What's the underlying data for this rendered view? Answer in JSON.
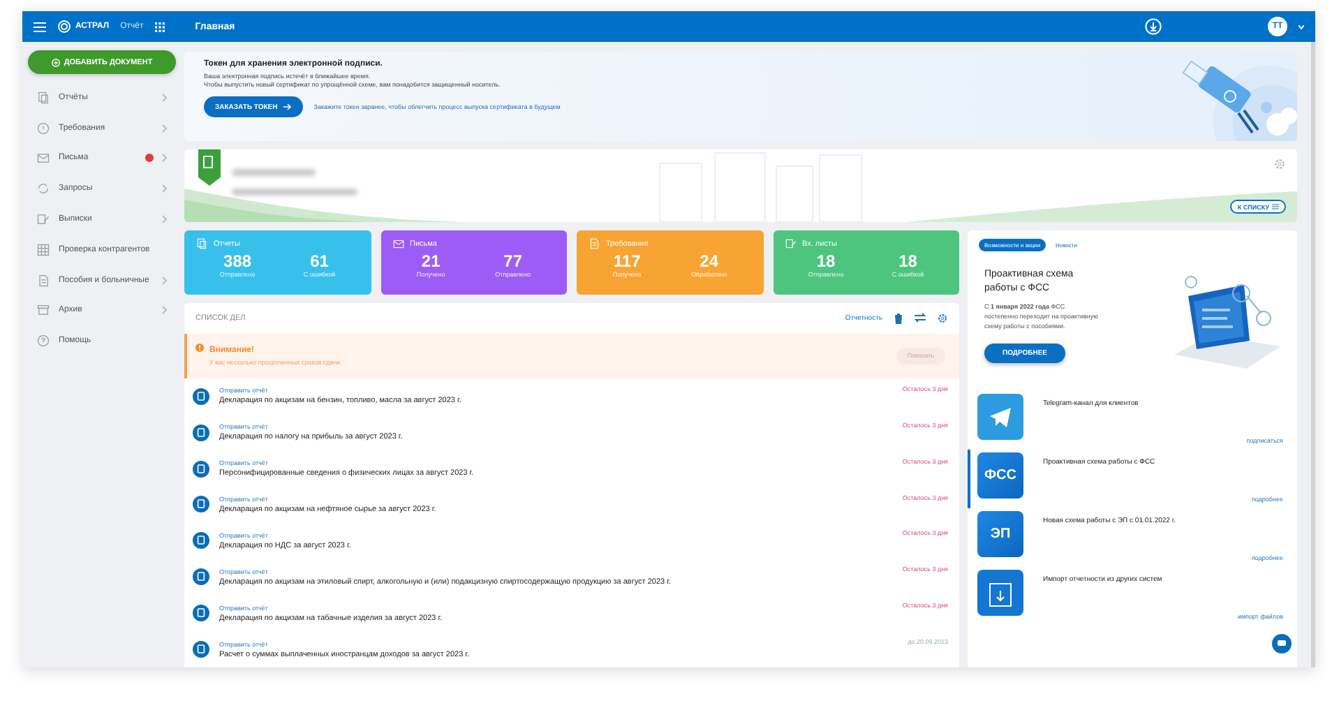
{
  "header": {
    "brand": "АСТРАЛ",
    "product": "Отчёт",
    "title": "Главная",
    "avatar": "ТТ"
  },
  "sidebar": {
    "add_button": "ДОБАВИТЬ ДОКУМЕНТ",
    "items": [
      {
        "label": "Отчёты",
        "has_arrow": true,
        "badge": false
      },
      {
        "label": "Требования",
        "has_arrow": true,
        "badge": false
      },
      {
        "label": "Письма",
        "has_arrow": true,
        "badge": true
      },
      {
        "label": "Запросы",
        "has_arrow": true,
        "badge": false
      },
      {
        "label": "Выписки",
        "has_arrow": true,
        "badge": false
      },
      {
        "label": "Проверка контрагентов",
        "has_arrow": false,
        "badge": false
      },
      {
        "label": "Пособия и больничные",
        "has_arrow": true,
        "badge": false
      },
      {
        "label": "Архив",
        "has_arrow": true,
        "badge": false
      },
      {
        "label": "Помощь",
        "has_arrow": false,
        "badge": false
      }
    ]
  },
  "token_banner": {
    "title": "Токен для хранения электронной подписи.",
    "lines": [
      "Ваша электронная подпись истечёт в ближайшее время.",
      "Чтобы выпустить новый сертификат по упрощённой схеме, вам понадобится защищенный носитель."
    ],
    "button": "ЗАКАЗАТЬ ТОКЕН",
    "note": "Закажите токен заранее, чтобы облегчить процесс выпуска сертификата в будущем"
  },
  "company_card": {
    "list_button": "К СПИСКУ"
  },
  "stats": [
    {
      "title": "Отчеты",
      "color": "#38c0ec",
      "values": [
        {
          "number": "388",
          "caption": "Отправлено"
        },
        {
          "number": "61",
          "caption": "С ошибкой"
        }
      ]
    },
    {
      "title": "Письма",
      "color": "#9d5cf5",
      "values": [
        {
          "number": "21",
          "caption": "Получено"
        },
        {
          "number": "77",
          "caption": "Отправлено"
        }
      ]
    },
    {
      "title": "Требования",
      "color": "#f8a433",
      "values": [
        {
          "number": "117",
          "caption": "Получено"
        },
        {
          "number": "24",
          "caption": "Обработано"
        }
      ]
    },
    {
      "title": "Вх. листы",
      "color": "#4dc57f",
      "values": [
        {
          "number": "18",
          "caption": "Отправлено"
        },
        {
          "number": "18",
          "caption": "С ошибкой"
        }
      ]
    }
  ],
  "tasks": {
    "title": "СПИСОК ДЕЛ",
    "filter_link": "Отчетность",
    "warning": {
      "title": "Внимание!",
      "text": "У вас несколько просроченных сроков сдачи",
      "button": "Показать"
    },
    "rows": [
      {
        "action": "Отправить отчёт",
        "title": "Декларация по акцизам на бензин, топливо, масла за август 2023 г.",
        "deadline": "Осталось 3 дня",
        "urgent": true
      },
      {
        "action": "Отправить отчёт",
        "title": "Декларация по налогу на прибыль за август 2023 г.",
        "deadline": "Осталось 3 дня",
        "urgent": true
      },
      {
        "action": "Отправить отчёт",
        "title": "Персонифицированные сведения о физических лицах за август 2023 г.",
        "deadline": "Осталось 3 дня",
        "urgent": true
      },
      {
        "action": "Отправить отчёт",
        "title": "Декларация по акцизам на нефтяное сырье за август 2023 г.",
        "deadline": "Осталось 3 дня",
        "urgent": true
      },
      {
        "action": "Отправить отчёт",
        "title": "Декларация по НДС за август 2023 г.",
        "deadline": "Осталось 3 дня",
        "urgent": true
      },
      {
        "action": "Отправить отчёт",
        "title": "Декларация по акцизам на этиловый спирт, алкогольную и (или) подакцизную спиртосодержащую продукцию за август 2023 г.",
        "deadline": "Осталось 3 дня",
        "urgent": true
      },
      {
        "action": "Отправить отчёт",
        "title": "Декларация по акцизам на табачные изделия за август 2023 г.",
        "deadline": "Осталось 3 дня",
        "urgent": true
      },
      {
        "action": "Отправить отчёт",
        "title": "Расчет о суммах выплаченных иностранцам доходов за август 2023 г.",
        "deadline": "до 20.09.2023",
        "urgent": false
      }
    ]
  },
  "news_panel": {
    "tabs": [
      {
        "label": "Возможности и акции",
        "selected": true
      },
      {
        "label": "Новости",
        "selected": false
      }
    ],
    "promo": {
      "title": "Проактивная схема работы с ФСС",
      "text": "С **1 января 2022 года** ФСС постепенно переходит на проактивную схему работы с пособиями.",
      "button": "ПОДРОБНЕЕ"
    },
    "items": [
      {
        "kind": "telegram",
        "title": "Telegram-канал для клиентов",
        "link": "подписаться",
        "selected": false
      },
      {
        "kind": "label",
        "tile": "ФСС",
        "title": "Проактивная схема работы с ФСС",
        "link": "подробнее",
        "selected": true
      },
      {
        "kind": "label",
        "tile": "ЭП",
        "title": "Новая схема работы с ЭП с 01.01.2022 г.",
        "link": "подробнее",
        "selected": false
      },
      {
        "kind": "import",
        "title": "Импорт отчетности из других систем",
        "link": "импорт файлов",
        "selected": false
      }
    ]
  }
}
